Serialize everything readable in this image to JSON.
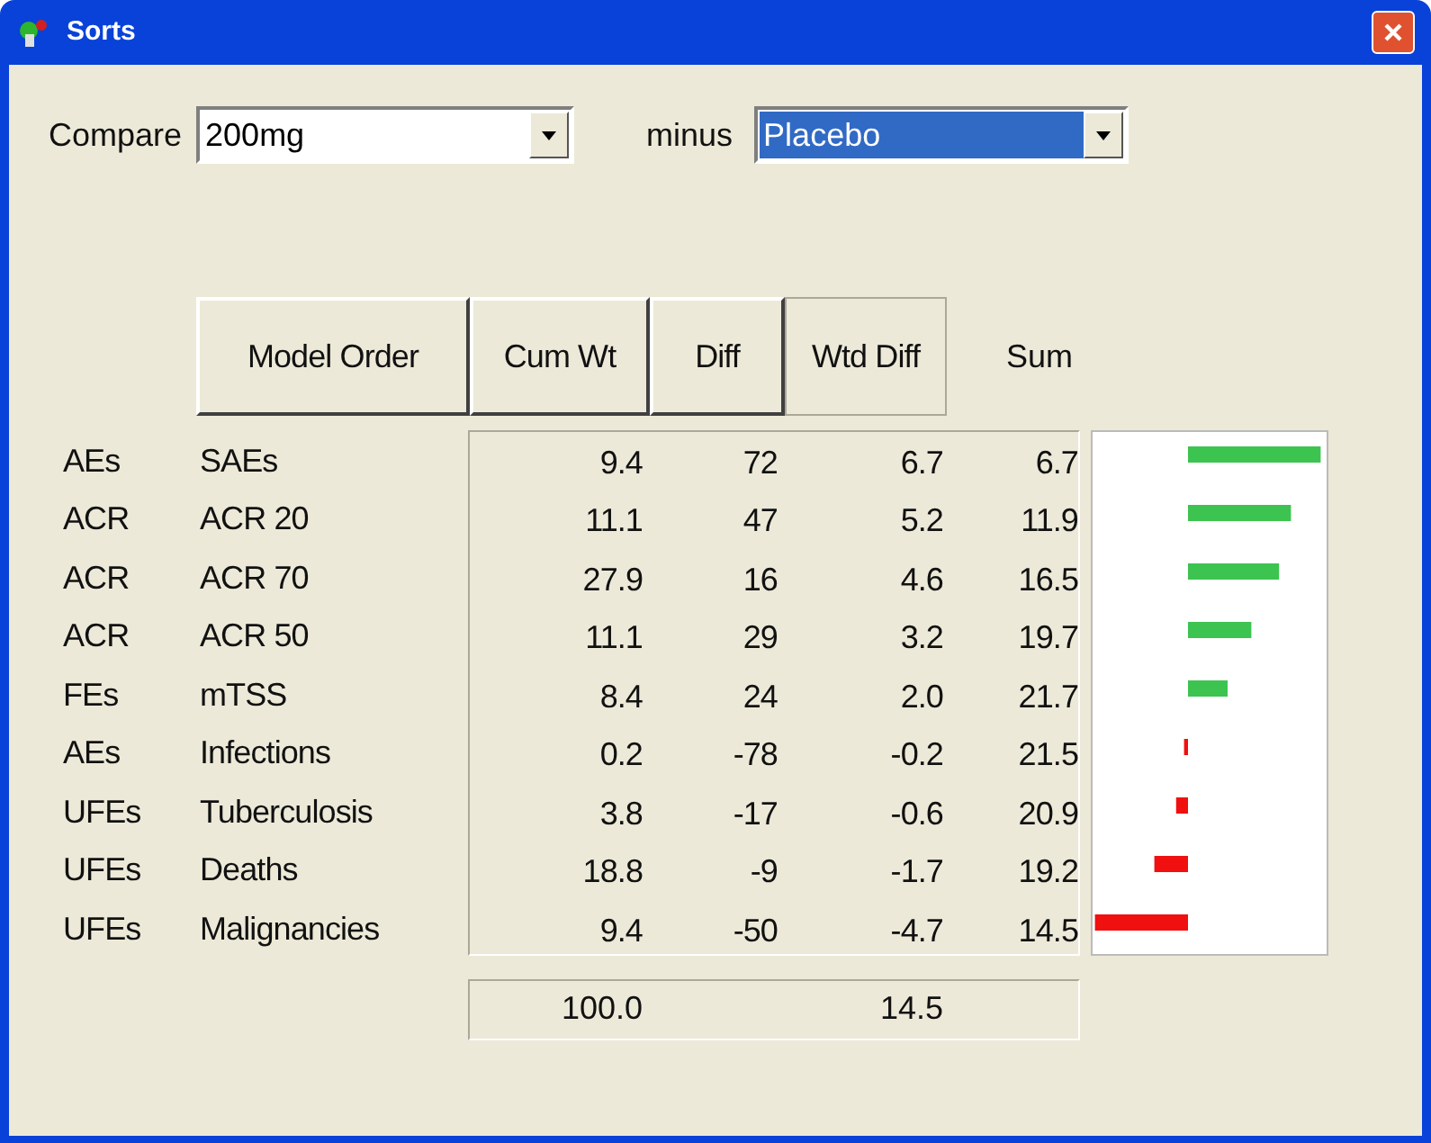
{
  "window": {
    "title": "Sorts"
  },
  "compare": {
    "label": "Compare",
    "value": "200mg",
    "selected": false
  },
  "minus": {
    "label": "minus",
    "value": "Placebo",
    "selected": true
  },
  "columns": [
    {
      "label": "Model Order",
      "selected": false
    },
    {
      "label": "Cum Wt",
      "selected": false
    },
    {
      "label": "Diff",
      "selected": false
    },
    {
      "label": "Wtd Diff",
      "selected": true
    }
  ],
  "sum_label": "Sum",
  "rows": [
    {
      "group": "AEs",
      "name": "SAEs",
      "cum_wt": "9.4",
      "diff": "72",
      "wtd_diff": "6.7",
      "sum": "6.7"
    },
    {
      "group": "ACR",
      "name": "ACR 20",
      "cum_wt": "11.1",
      "diff": "47",
      "wtd_diff": "5.2",
      "sum": "11.9"
    },
    {
      "group": "ACR",
      "name": "ACR 70",
      "cum_wt": "27.9",
      "diff": "16",
      "wtd_diff": "4.6",
      "sum": "16.5"
    },
    {
      "group": "ACR",
      "name": "ACR 50",
      "cum_wt": "11.1",
      "diff": "29",
      "wtd_diff": "3.2",
      "sum": "19.7"
    },
    {
      "group": "FEs",
      "name": "mTSS",
      "cum_wt": "8.4",
      "diff": "24",
      "wtd_diff": "2.0",
      "sum": "21.7"
    },
    {
      "group": "AEs",
      "name": "Infections",
      "cum_wt": "0.2",
      "diff": "-78",
      "wtd_diff": "-0.2",
      "sum": "21.5"
    },
    {
      "group": "UFEs",
      "name": "Tuberculosis",
      "cum_wt": "3.8",
      "diff": "-17",
      "wtd_diff": "-0.6",
      "sum": "20.9"
    },
    {
      "group": "UFEs",
      "name": "Deaths",
      "cum_wt": "18.8",
      "diff": "-9",
      "wtd_diff": "-1.7",
      "sum": "19.2"
    },
    {
      "group": "UFEs",
      "name": "Malignancies",
      "cum_wt": "9.4",
      "diff": "-50",
      "wtd_diff": "-4.7",
      "sum": "14.5"
    }
  ],
  "totals": {
    "cum_wt": "100.0",
    "wtd_diff": "14.5"
  }
}
